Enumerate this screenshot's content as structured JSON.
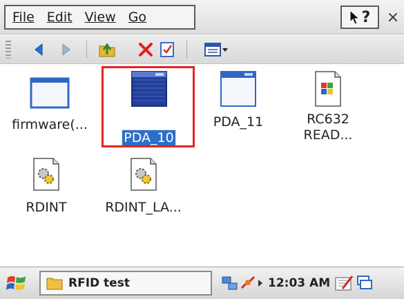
{
  "menu": {
    "file": "File",
    "edit": "Edit",
    "view": "View",
    "go": "Go",
    "help_glyph": "?",
    "close_glyph": "×"
  },
  "toolbar": {
    "icons": [
      "back-icon",
      "forward-icon",
      "up-folder-icon",
      "delete-icon",
      "properties-icon",
      "views-icon",
      "dropdown-icon"
    ]
  },
  "files": [
    {
      "label": "firmware(...",
      "icon": "window-file-icon",
      "selected": false
    },
    {
      "label": "PDA_10",
      "icon": "window-file-icon",
      "selected": true
    },
    {
      "label": "PDA_11",
      "icon": "window-file-icon",
      "selected": false
    },
    {
      "label": "RC632\nREAD...",
      "icon": "document-file-icon",
      "selected": false
    },
    {
      "label": "RDINT",
      "icon": "executable-file-icon",
      "selected": false
    },
    {
      "label": "RDINT_LA...",
      "icon": "executable-file-icon",
      "selected": false
    }
  ],
  "taskbar": {
    "task_label": "RFID test",
    "clock": "12:03 AM"
  },
  "colors": {
    "selection": "#2d6fc8",
    "highlight_box": "#e02424"
  }
}
